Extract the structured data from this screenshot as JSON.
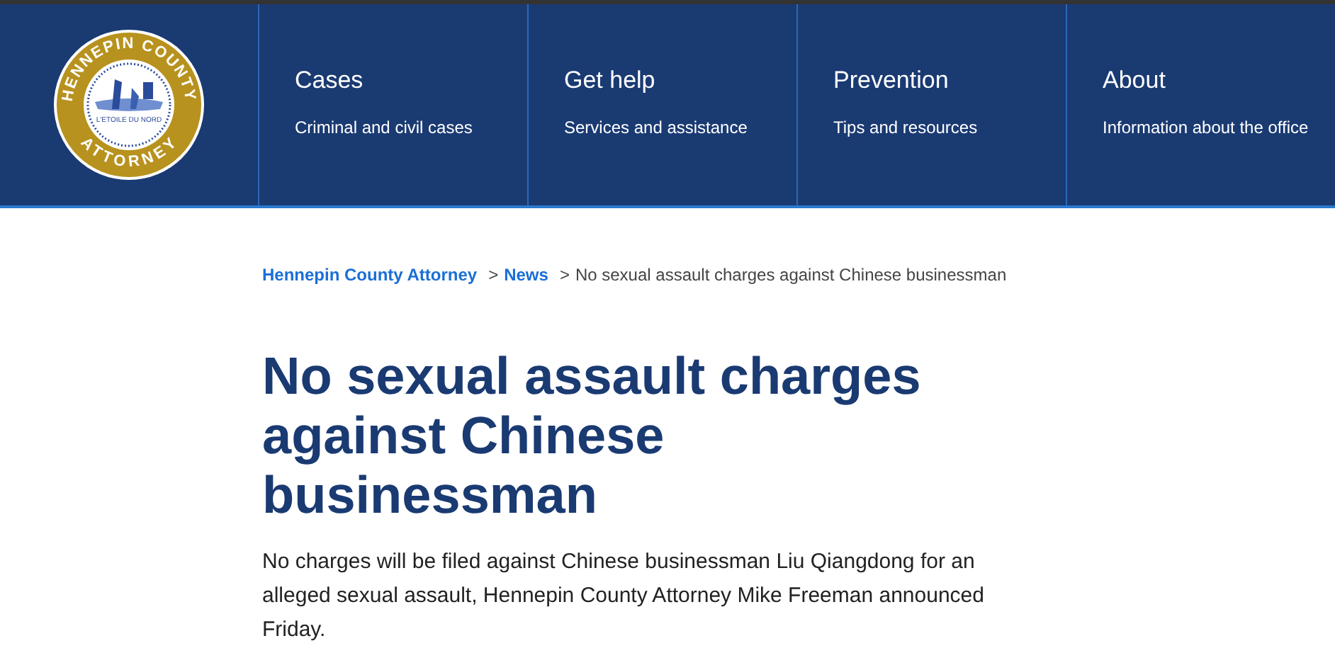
{
  "header": {
    "logo": {
      "top_text": "HENNEPIN COUNTY",
      "bottom_text": "ATTORNEY",
      "inner_text": "L'ETOILE DU NORD"
    },
    "nav": [
      {
        "title": "Cases",
        "subtitle": "Criminal and civil cases"
      },
      {
        "title": "Get help",
        "subtitle": "Services and assistance"
      },
      {
        "title": "Prevention",
        "subtitle": "Tips and resources"
      },
      {
        "title": "About",
        "subtitle": "Information about the office"
      }
    ]
  },
  "breadcrumb": {
    "separator": ">",
    "items": [
      {
        "label": "Hennepin County Attorney",
        "kind": "link"
      },
      {
        "label": "News",
        "kind": "link"
      },
      {
        "label": "No sexual assault charges against Chinese businessman",
        "kind": "current"
      }
    ]
  },
  "article": {
    "title": "No sexual assault charges against Chinese businessman",
    "lead": "No charges will be filed against Chinese businessman Liu Qiangdong for an alleged sexual assault, Hennepin County Attorney Mike Freeman announced Friday."
  }
}
